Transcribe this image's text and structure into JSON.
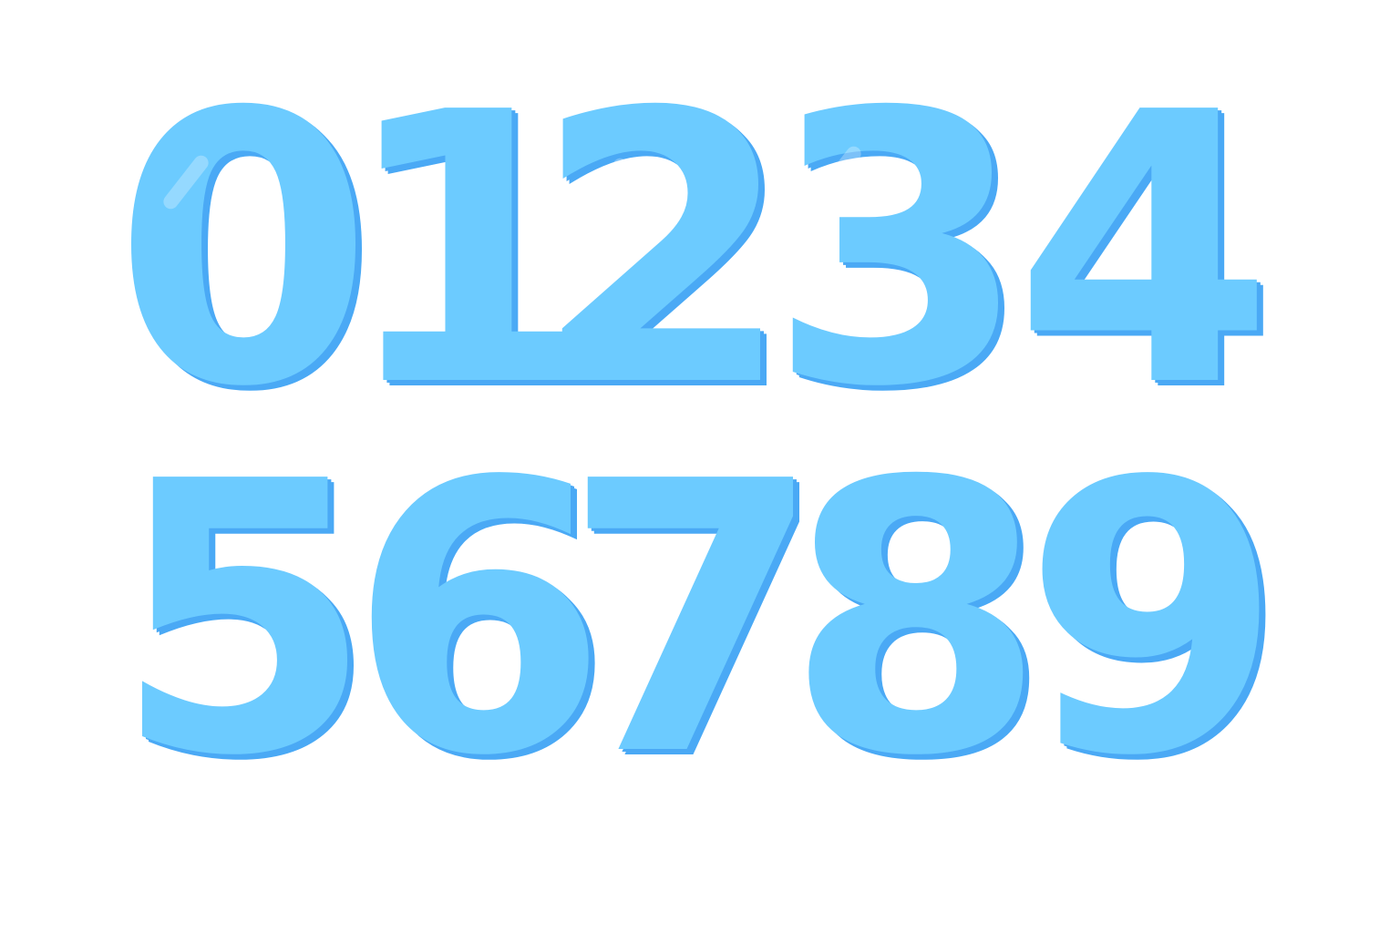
{
  "colors": {
    "background": "#ffffff",
    "digit_fill": "#6ccbff",
    "digit_shadow": "#4aa9f5"
  },
  "digits": {
    "top_row": [
      "0",
      "1",
      "2",
      "3",
      "4"
    ],
    "bottom_row": [
      "5",
      "6",
      "7",
      "8",
      "9"
    ]
  }
}
